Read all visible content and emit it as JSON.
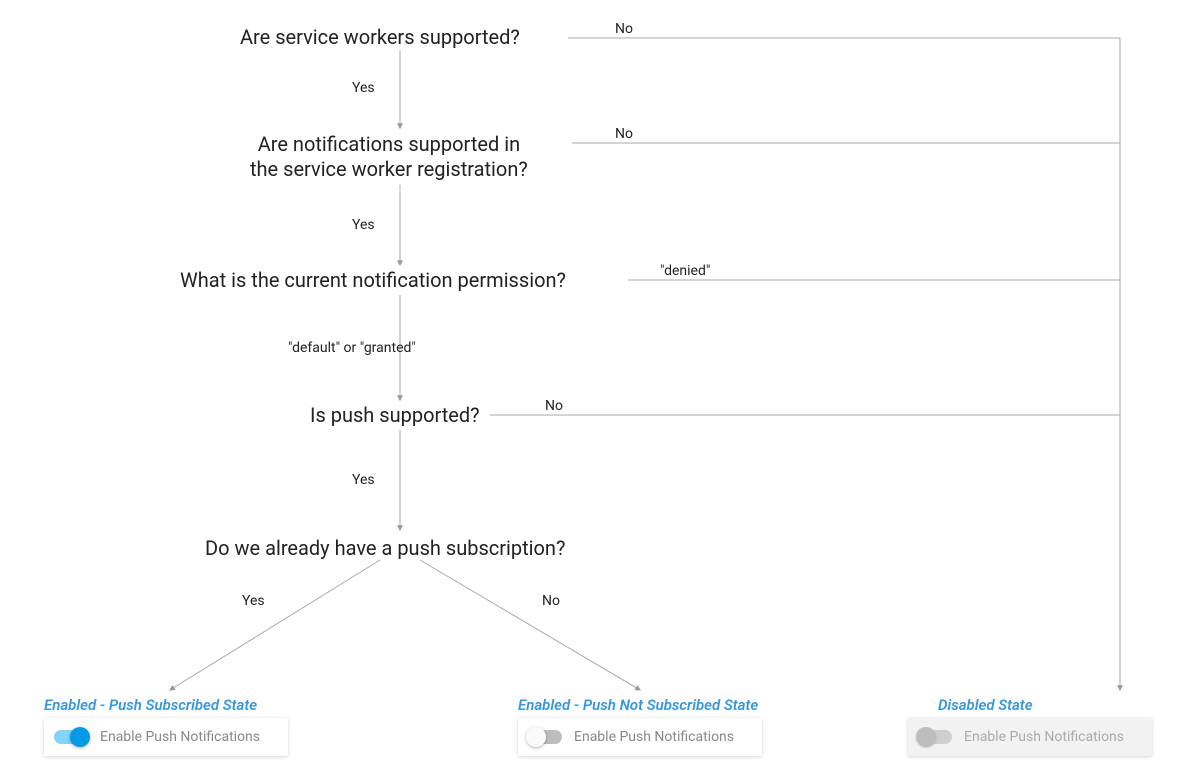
{
  "nodes": {
    "q1": "Are service workers supported?",
    "q2_line1": "Are notifications supported in",
    "q2_line2": "the service worker registration?",
    "q3": "What is the current notification permission?",
    "q4": "Is push supported?",
    "q5": "Do we already have a push subscription?"
  },
  "edges": {
    "q1_yes": "Yes",
    "q1_no": "No",
    "q2_yes": "Yes",
    "q2_no": "No",
    "q3_pass": "\"default\" or \"granted\"",
    "q3_no": "\"denied\"",
    "q4_yes": "Yes",
    "q4_no": "No",
    "q5_yes": "Yes",
    "q5_no": "No"
  },
  "states": {
    "enabled_subscribed": {
      "title": "Enabled - Push Subscribed State",
      "toggle_label": "Enable Push Notifications"
    },
    "enabled_not_subscribed": {
      "title": "Enabled - Push Not Subscribed State",
      "toggle_label": "Enable Push Notifications"
    },
    "disabled": {
      "title": "Disabled State",
      "toggle_label": "Enable Push Notifications"
    }
  }
}
